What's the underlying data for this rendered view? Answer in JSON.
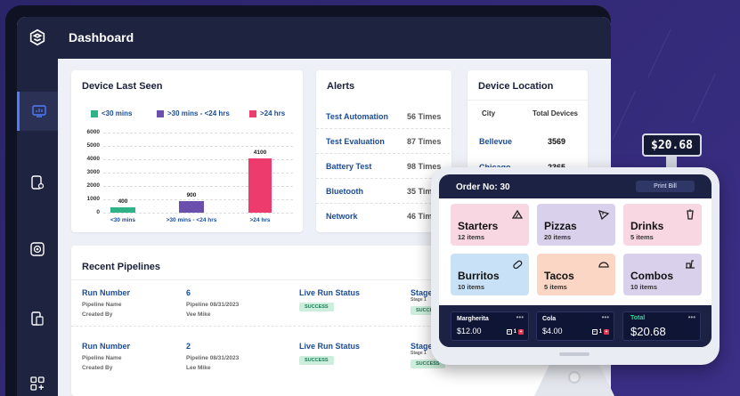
{
  "app": {
    "title": "Dashboard"
  },
  "colors": {
    "accent": "#4f7cff",
    "bar_lt30": "#2fb386",
    "bar_30_24": "#6b4fad",
    "bar_gt24": "#ee3b6d",
    "link": "#1a4c9a"
  },
  "sidebar": {
    "icons": [
      "monitor-icon",
      "tablet-add-icon",
      "camera-icon",
      "devices-icon",
      "grid-add-icon"
    ]
  },
  "device_last_seen": {
    "title": "Device Last Seen",
    "legend": [
      "<30 mins",
      ">30 mins - <24 hrs",
      ">24 hrs"
    ],
    "yticks": [
      "6000",
      "5000",
      "4000",
      "3000",
      "2000",
      "1000",
      "0"
    ],
    "bar_labels": [
      "400",
      "900",
      "4100"
    ],
    "x_labels": [
      "<30 mins",
      ">30 mins - <24 hrs",
      ">24 hrs"
    ]
  },
  "chart_data": {
    "type": "bar",
    "title": "Device Last Seen",
    "categories": [
      "<30 mins",
      ">30 mins - <24 hrs",
      ">24 hrs"
    ],
    "values": [
      400,
      900,
      4100
    ],
    "ylim": [
      0,
      6000
    ],
    "legend": "top",
    "grid": true
  },
  "alerts": {
    "title": "Alerts",
    "rows": [
      {
        "name": "Test Automation",
        "value": "56 Times"
      },
      {
        "name": "Test Evaluation",
        "value": "87 Times"
      },
      {
        "name": "Battery Test",
        "value": "98 Times"
      },
      {
        "name": "Bluetooth",
        "value": "35 Tim"
      },
      {
        "name": "Network",
        "value": "46 Tim"
      }
    ]
  },
  "device_location": {
    "title": "Device Location",
    "headers": [
      "City",
      "Total Devices"
    ],
    "rows": [
      {
        "city": "Bellevue",
        "count": "3569"
      },
      {
        "city": "Chicago",
        "count": "2365"
      }
    ]
  },
  "pipelines": {
    "title": "Recent Pipelines",
    "rows": [
      {
        "run_label": "Run Number",
        "run_number": "6",
        "pipeline_name_lbl": "Pipeline Name",
        "created_by_lbl": "Created By",
        "pipeline_date": "Pipeline 08/31/2023",
        "creator": "Vee Mike",
        "status_lbl": "Live Run Status",
        "status": "SUCCESS",
        "stage_lbl": "Stage S",
        "stage_sub": "Stage 1",
        "stage_status": "SUCCE"
      },
      {
        "run_label": "Run Number",
        "run_number": "2",
        "pipeline_name_lbl": "Pipeline Name",
        "created_by_lbl": "Created By",
        "pipeline_date": "Pipeline 08/31/2023",
        "creator": "Lee Mike",
        "status_lbl": "Live Run Status",
        "status": "SUCCESS",
        "stage_lbl": "Stage S",
        "stage_sub": "Stage 1",
        "stage_status": "SUCCESS"
      }
    ]
  },
  "price_tag": "$20.68",
  "pos": {
    "order": "Order No: 30",
    "print_bill": "Print Bill",
    "tiles": [
      {
        "name": "Starters",
        "count": "12 items",
        "color": "#f8d7e3",
        "icon": "nachos-icon"
      },
      {
        "name": "Pizzas",
        "count": "20 items",
        "color": "#d9d1ec",
        "icon": "pizza-icon"
      },
      {
        "name": "Drinks",
        "count": "5 items",
        "color": "#f8d7e3",
        "icon": "cup-icon"
      },
      {
        "name": "Burritos",
        "count": "10 items",
        "color": "#c9e1f6",
        "icon": "burrito-icon"
      },
      {
        "name": "Tacos",
        "count": "5 items",
        "color": "#fbd6c4",
        "icon": "taco-icon"
      },
      {
        "name": "Combos",
        "count": "10 items",
        "color": "#d9d1ec",
        "icon": "combo-icon"
      }
    ],
    "cart": [
      {
        "name": "Margherita",
        "price": "$12.00",
        "qty": "1"
      },
      {
        "name": "Cola",
        "price": "$4.00",
        "qty": "1"
      }
    ],
    "total_label": "Total",
    "total_value": "$20.68"
  }
}
